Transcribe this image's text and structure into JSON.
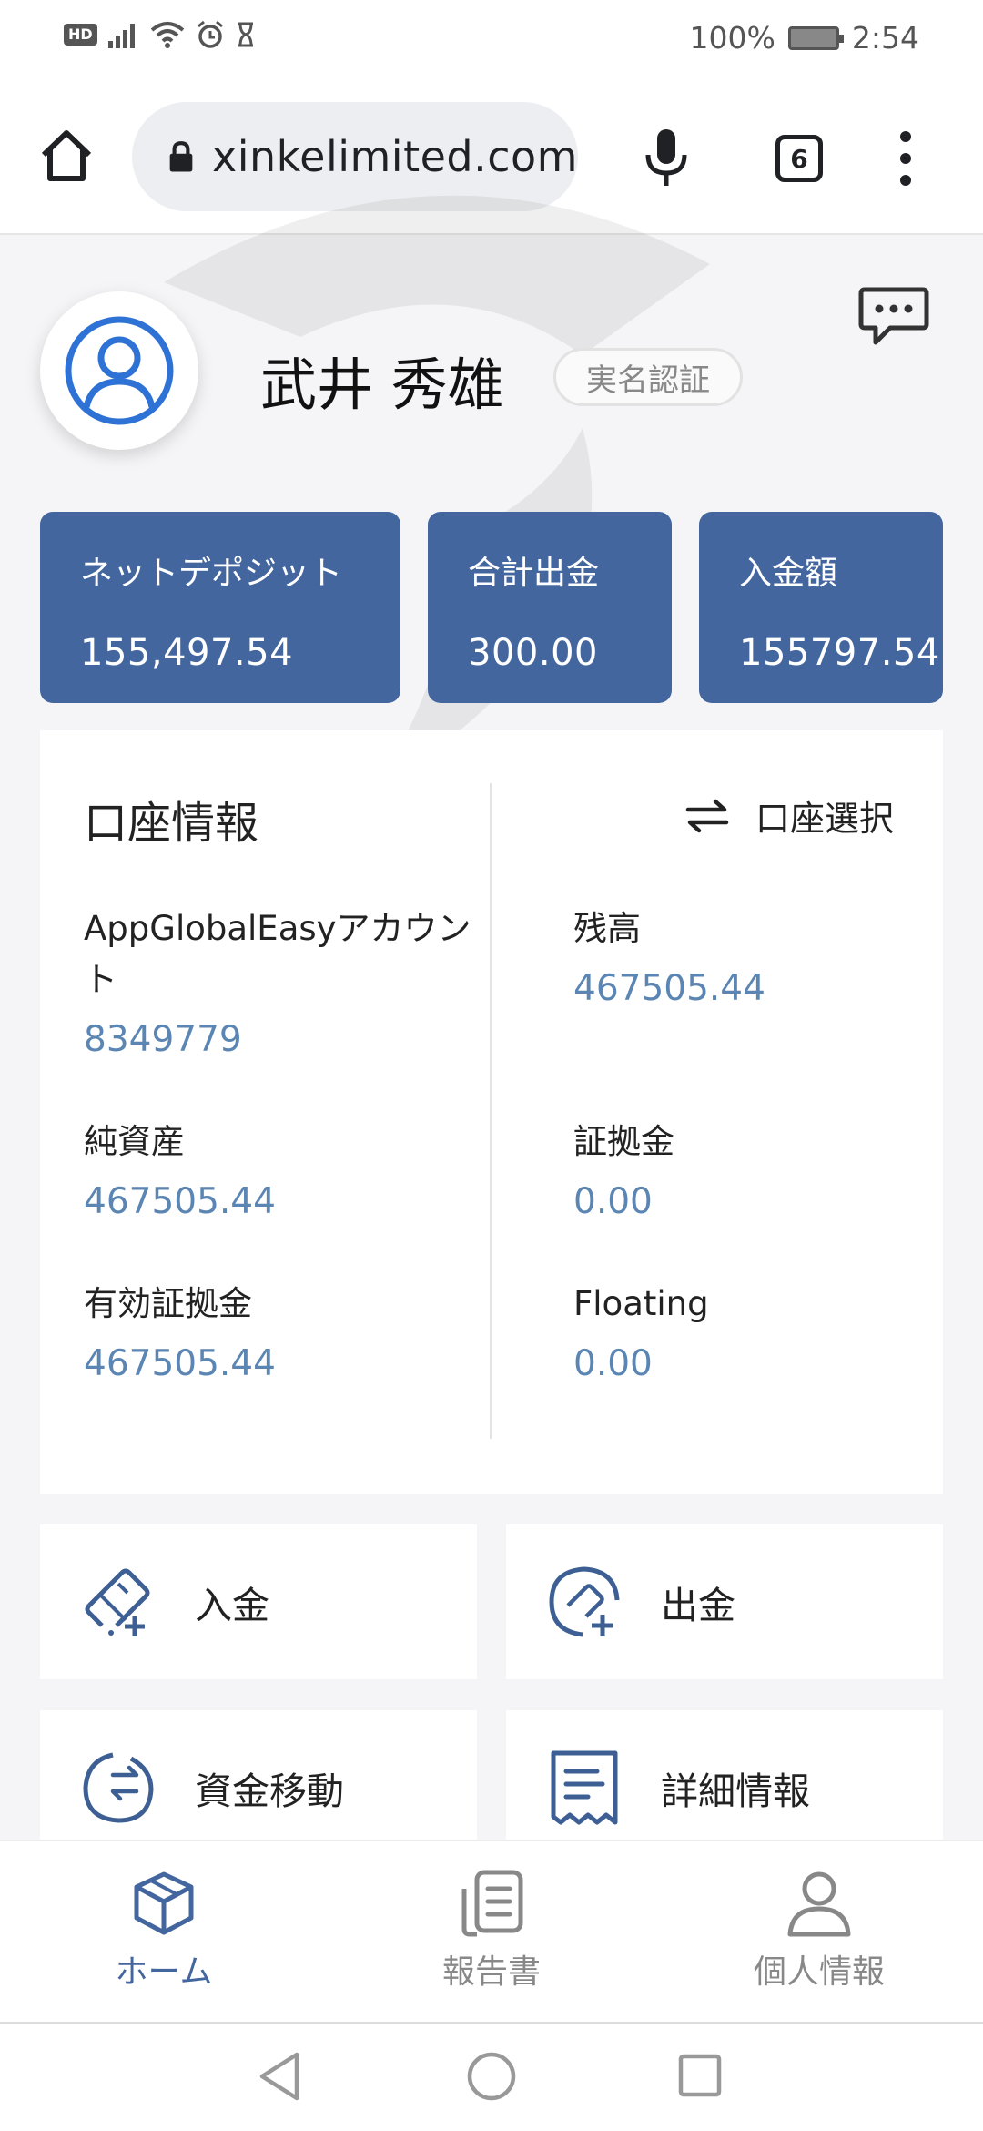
{
  "status_bar": {
    "hd_badge": "HD",
    "battery": "100%",
    "time": "2:54"
  },
  "browser": {
    "url": "xinkelimited.com",
    "tab_count": "6"
  },
  "profile": {
    "name": "武井 秀雄",
    "verify_badge": "実名認証"
  },
  "stats": {
    "net_deposit_label": "ネットデポジット",
    "net_deposit_value": "155,497.54",
    "total_withdraw_label": "合計出金",
    "total_withdraw_value": "300.00",
    "deposit_amount_label": "入金額",
    "deposit_amount_value": "155797.54"
  },
  "account": {
    "title": "口座情報",
    "switch_label": "口座選択",
    "account_type_label": "AppGlobalEasyアカウント",
    "account_number": "8349779",
    "balance_label": "残高",
    "balance_value": "467505.44",
    "equity_label": "純資産",
    "equity_value": "467505.44",
    "margin_label": "証拠金",
    "margin_value": "0.00",
    "free_margin_label": "有効証拠金",
    "free_margin_value": "467505.44",
    "floating_label": "Floating",
    "floating_value": "0.00"
  },
  "actions": {
    "deposit": "入金",
    "withdraw": "出金",
    "transfer": "資金移動",
    "details": "詳細情報"
  },
  "bottom_nav": {
    "home": "ホーム",
    "report": "報告書",
    "profile": "個人情報"
  },
  "colors": {
    "card_blue": "#44669f",
    "value_blue": "#5b86b3",
    "icon_blue": "#3d5f94",
    "avatar_blue": "#2f72d6"
  }
}
